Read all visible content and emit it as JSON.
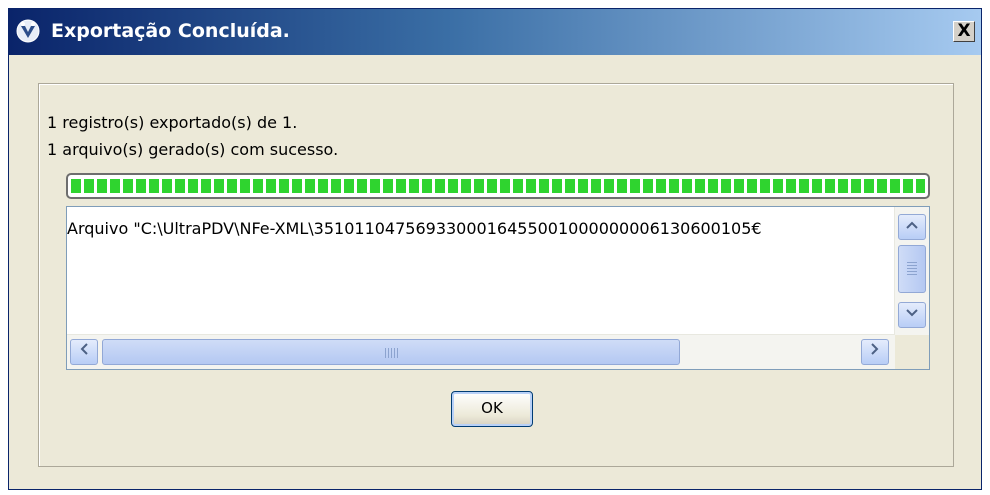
{
  "window": {
    "title": "Exportação Concluída.",
    "close_label": "X"
  },
  "messages": {
    "records_exported": "1 registro(s) exportado(s) de 1.",
    "files_generated": "1 arquivo(s) gerado(s) com sucesso."
  },
  "progress": {
    "percent": 100
  },
  "log": {
    "lines": [
      "Arquivo \"C:\\UltraPDV\\NFe-XML\\3510110475693300016455001000000006130600105€"
    ]
  },
  "buttons": {
    "ok_label": "OK"
  },
  "icons": {
    "app": "app-logo-icon",
    "close": "close-icon",
    "scroll_up": "chevron-up-icon",
    "scroll_down": "chevron-down-icon",
    "scroll_left": "chevron-left-icon",
    "scroll_right": "chevron-right-icon"
  },
  "colors": {
    "titlebar_start": "#0a246a",
    "titlebar_end": "#a6caf0",
    "progress_fill": "#2fd42f",
    "dialog_bg": "#ece9d8"
  }
}
